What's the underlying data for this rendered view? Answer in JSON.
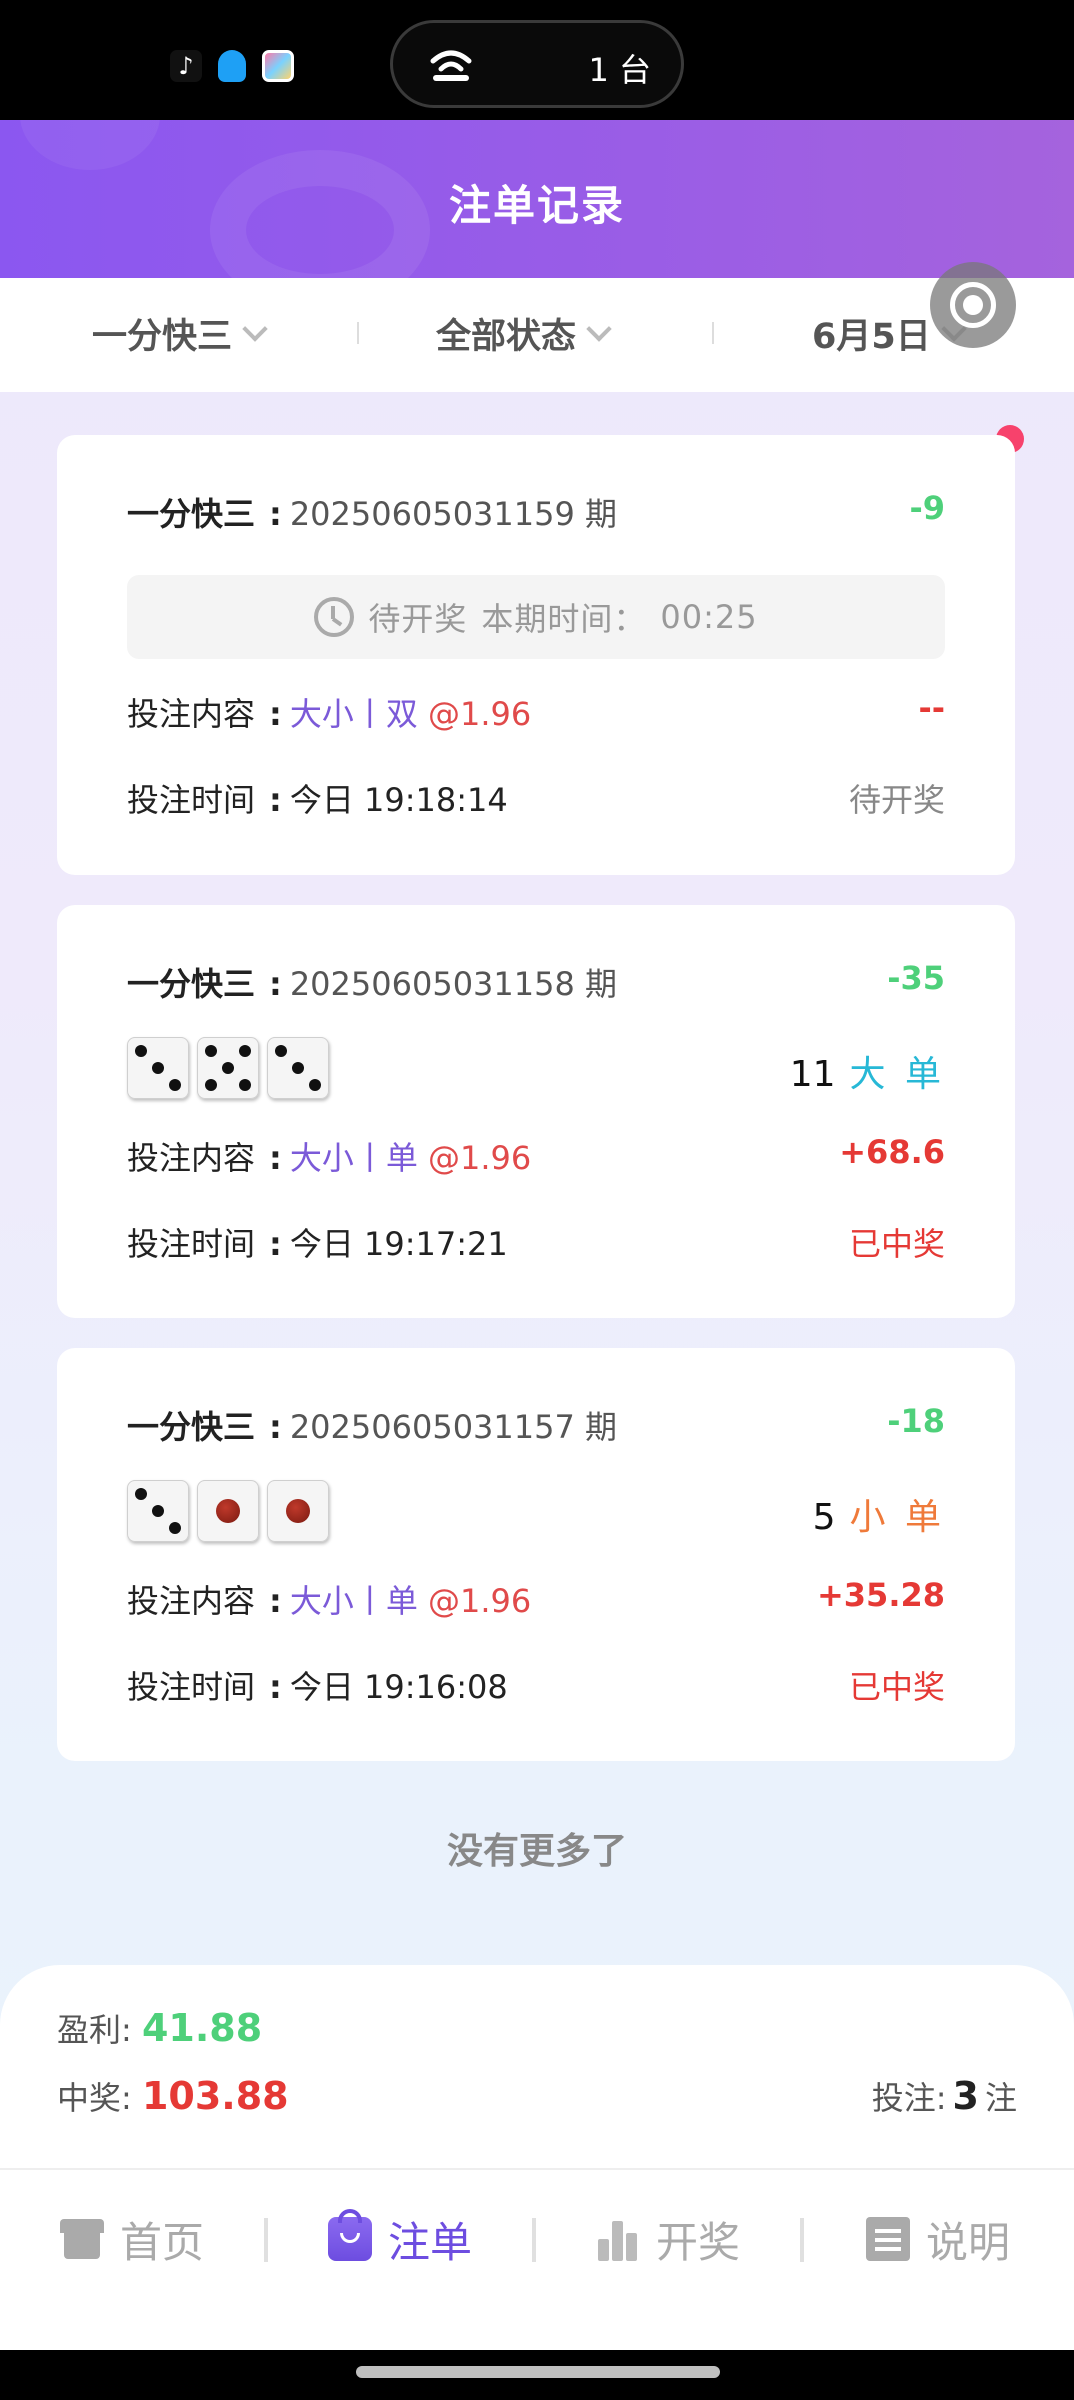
{
  "status_bar": {
    "app_icons": [
      "tiktok-icon",
      "qq-icon",
      "app-icon"
    ],
    "pill_label": "1 台"
  },
  "header": {
    "title": "注单记录"
  },
  "filters": {
    "game": "一分快三",
    "status": "全部状态",
    "date": "6月5日"
  },
  "cards": [
    {
      "game": "一分快三",
      "period": "20250605031159 期",
      "amount": "-9",
      "pending_label": "待开奖",
      "period_time_label": "本期时间：",
      "countdown": "00:25",
      "bet_label": "投注内容",
      "bet_type": "大小丨双",
      "bet_odds": "@1.96",
      "payout": "--",
      "time_label": "投注时间",
      "bet_time": "今日 19:18:14",
      "status": "待开奖"
    },
    {
      "game": "一分快三",
      "period": "20250605031158 期",
      "amount": "-35",
      "dice": [
        3,
        5,
        3
      ],
      "result_sum": "11",
      "result_text": "大 单",
      "bet_label": "投注内容",
      "bet_type": "大小丨单",
      "bet_odds": "@1.96",
      "payout": "+68.6",
      "time_label": "投注时间",
      "bet_time": "今日 19:17:21",
      "status": "已中奖"
    },
    {
      "game": "一分快三",
      "period": "20250605031157 期",
      "amount": "-18",
      "dice": [
        3,
        1,
        1
      ],
      "result_sum": "5",
      "result_text": "小 单",
      "bet_label": "投注内容",
      "bet_type": "大小丨单",
      "bet_odds": "@1.96",
      "payout": "+35.28",
      "time_label": "投注时间",
      "bet_time": "今日 19:16:08",
      "status": "已中奖"
    }
  ],
  "no_more": "没有更多了",
  "summary": {
    "profit_label": "盈利:",
    "profit_value": "41.88",
    "win_label": "中奖:",
    "win_value": "103.88",
    "bets_label": "投注:",
    "bets_value": "3",
    "bets_unit": "注"
  },
  "tabs": [
    {
      "label": "首页",
      "icon": "store-icon"
    },
    {
      "label": "注单",
      "icon": "bag-icon",
      "active": true
    },
    {
      "label": "开奖",
      "icon": "bar-chart-icon"
    },
    {
      "label": "说明",
      "icon": "document-icon"
    }
  ],
  "colors": {
    "header_gradient_start": "#8b57f0",
    "header_gradient_end": "#a563dd",
    "active_tab": "#6d4de0",
    "profit_green": "#4ed07a",
    "win_red": "#e53935",
    "bet_purple": "#7b5ad8"
  }
}
